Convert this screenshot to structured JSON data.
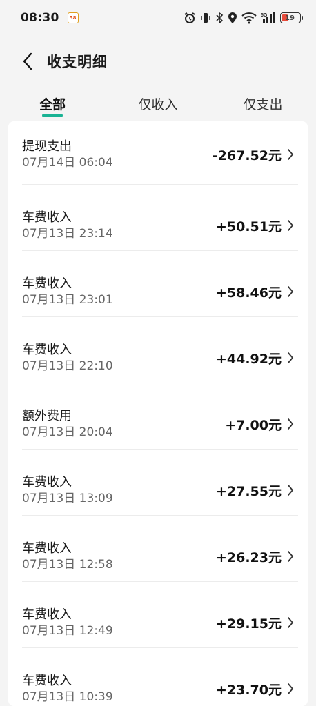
{
  "status_bar": {
    "time": "08:30",
    "app_notification": "58",
    "battery_level": "19",
    "network_label": "5G"
  },
  "header": {
    "title": "收支明细"
  },
  "tabs": [
    {
      "label": "全部",
      "active": true
    },
    {
      "label": "仅收入",
      "active": false
    },
    {
      "label": "仅支出",
      "active": false
    }
  ],
  "colors": {
    "accent": "#1ab394",
    "background": "#f4f4f4",
    "card": "#ffffff",
    "battery_low": "#e74c3c"
  },
  "transactions": [
    {
      "name": "提现支出",
      "time": "07月14日 06:04",
      "amount": "-267.52元"
    },
    {
      "name": "车费收入",
      "time": "07月13日 23:14",
      "amount": "+50.51元"
    },
    {
      "name": "车费收入",
      "time": "07月13日 23:01",
      "amount": "+58.46元"
    },
    {
      "name": "车费收入",
      "time": "07月13日 22:10",
      "amount": "+44.92元"
    },
    {
      "name": "额外费用",
      "time": "07月13日 20:04",
      "amount": "+7.00元"
    },
    {
      "name": "车费收入",
      "time": "07月13日 13:09",
      "amount": "+27.55元"
    },
    {
      "name": "车费收入",
      "time": "07月13日 12:58",
      "amount": "+26.23元"
    },
    {
      "name": "车费收入",
      "time": "07月13日 12:49",
      "amount": "+29.15元"
    },
    {
      "name": "车费收入",
      "time": "07月13日 10:39",
      "amount": "+23.70元"
    }
  ]
}
